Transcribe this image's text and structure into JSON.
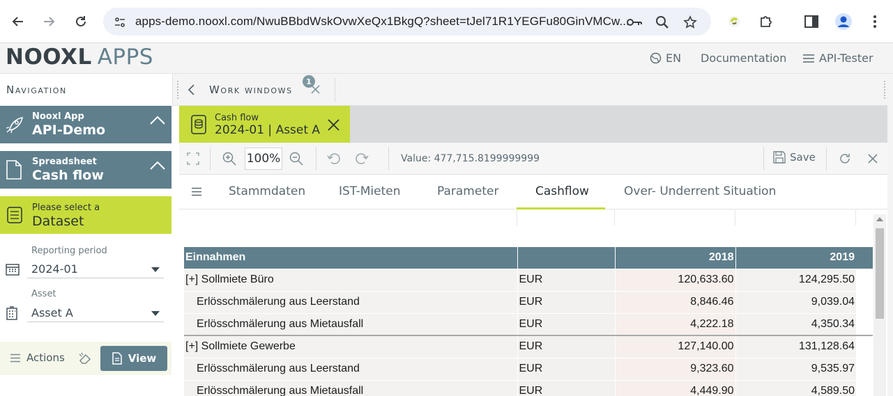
{
  "browser": {
    "url": "apps-demo.nooxl.com/NwuBBbdWskOvwXeQx1BkgQ?sheet=tJel71R1YEGFu80GinVMCw...",
    "icons": [
      "back-arrow-icon",
      "forward-arrow-icon",
      "reload-icon",
      "site-info-icon",
      "key-icon",
      "zoom-icon",
      "star-icon",
      "extension-icon",
      "puzzle-icon",
      "sidepanel-icon",
      "profile-icon",
      "menu-dots-icon"
    ]
  },
  "header": {
    "logo_bold": "NOOXL",
    "logo_light": "APPS",
    "language": "EN",
    "documentation": "Documentation",
    "api_tester": "API-Tester"
  },
  "sidebar": {
    "title": "Navigation",
    "app_card": {
      "small": "Nooxl App",
      "big": "API-Demo"
    },
    "spreadsheet_card": {
      "small": "Spreadsheet",
      "big": "Cash flow"
    },
    "dataset_card": {
      "small": "Please select a",
      "big": "Dataset"
    },
    "reporting_period": {
      "label": "Reporting period",
      "value": "2024-01"
    },
    "asset": {
      "label": "Asset",
      "value": "Asset A"
    },
    "actions_label": "Actions",
    "view_label": "View"
  },
  "work_windows": {
    "title": "Work windows",
    "count": "1",
    "active_tab": {
      "small": "Cash flow",
      "big": "2024-01 | Asset A"
    }
  },
  "toolbar": {
    "zoom": "100%",
    "value_text": "Value: 477,715.8199999999",
    "save_label": "Save"
  },
  "sheet_tabs": [
    {
      "label": "Stammdaten",
      "active": false
    },
    {
      "label": "IST-Mieten",
      "active": false
    },
    {
      "label": "Parameter",
      "active": false
    },
    {
      "label": "Cashflow",
      "active": true
    },
    {
      "label": "Over- Underrent Situation",
      "active": false
    }
  ],
  "grid": {
    "header": {
      "label": "Einnahmen",
      "unit": "",
      "col_2018": "2018",
      "col_2019": "2019"
    },
    "rows": [
      {
        "label": "[+] Sollmiete Büro",
        "unit": "EUR",
        "v2018": "120,633.60",
        "v2019": "124,295.50",
        "indent": false,
        "sep": false
      },
      {
        "label": "Erlösschmälerung aus Leerstand",
        "unit": "EUR",
        "v2018": "8,846.46",
        "v2019": "9,039.04",
        "indent": true,
        "sep": false
      },
      {
        "label": "Erlösschmälerung aus Mietausfall",
        "unit": "EUR",
        "v2018": "4,222.18",
        "v2019": "4,350.34",
        "indent": true,
        "sep": false
      },
      {
        "label": "[+] Sollmiete Gewerbe",
        "unit": "EUR",
        "v2018": "127,140.00",
        "v2019": "131,128.64",
        "indent": false,
        "sep": true
      },
      {
        "label": "Erlösschmälerung aus Leerstand",
        "unit": "EUR",
        "v2018": "9,323.60",
        "v2019": "9,535.97",
        "indent": true,
        "sep": false
      },
      {
        "label": "Erlösschmälerung aus Mietausfall",
        "unit": "EUR",
        "v2018": "4,449.90",
        "v2019": "4,589.50",
        "indent": true,
        "sep": false
      }
    ]
  },
  "colors": {
    "accent_lime": "#c7dc3b",
    "slate": "#5f7f8d",
    "dark": "#374248"
  }
}
